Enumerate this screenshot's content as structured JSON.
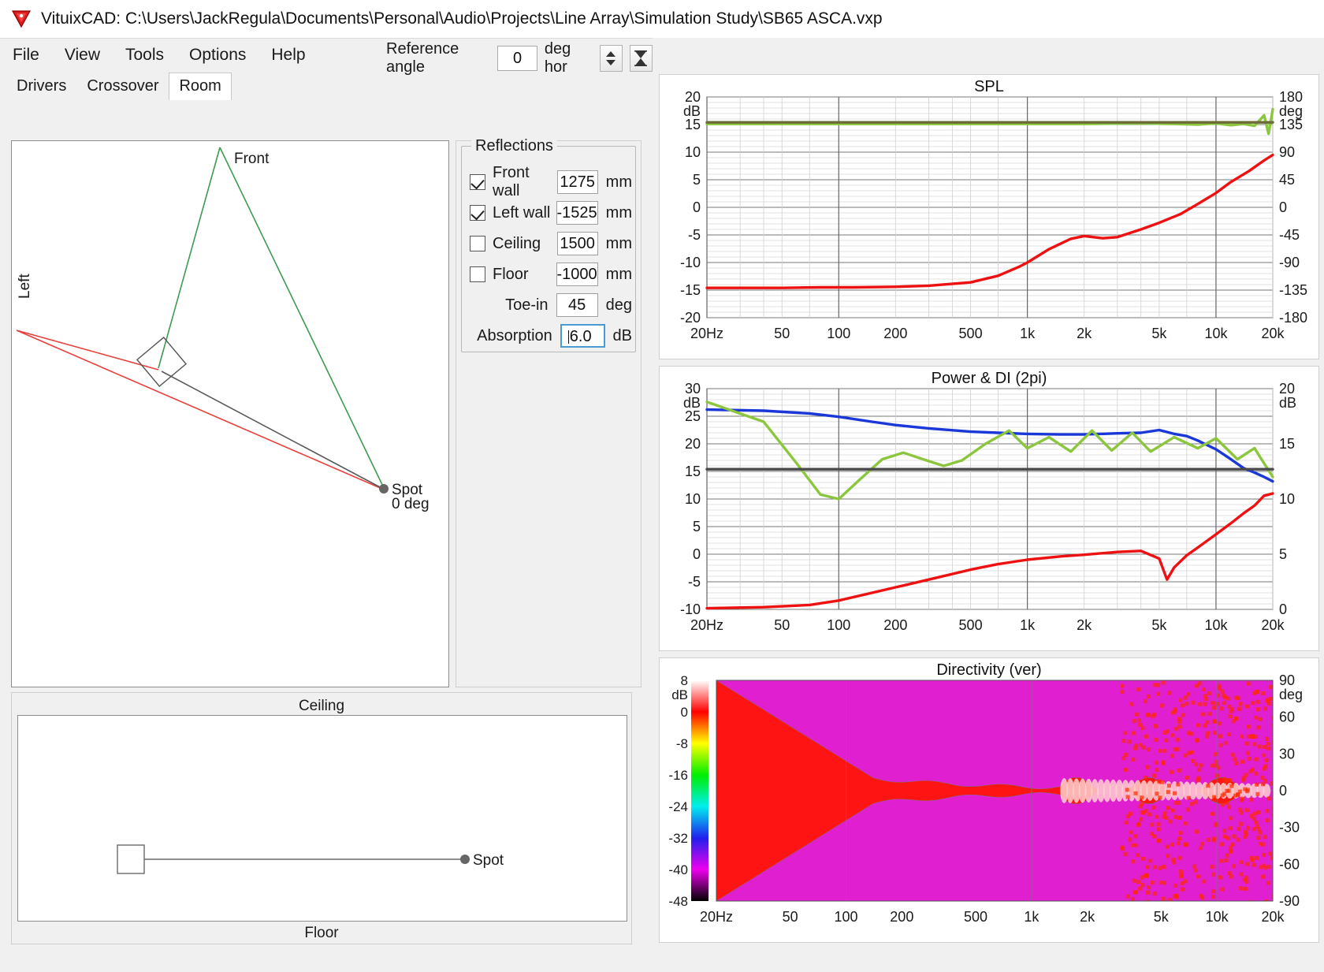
{
  "window": {
    "title": "VituixCAD: C:\\Users\\JackRegula\\Documents\\Personal\\Audio\\Projects\\Line Array\\Simulation Study\\SB65 ASCA.vxp",
    "logo_icon": "vituixcad-logo-icon"
  },
  "menubar": {
    "items": [
      "File",
      "View",
      "Tools",
      "Options",
      "Help"
    ],
    "reference_angle": {
      "label": "Reference angle",
      "value": "0",
      "unit": "deg hor",
      "spinner_icon": "up-down-spinner-icon",
      "hourglass_icon": "hourglass-icon"
    }
  },
  "tabs": {
    "items": [
      "Drivers",
      "Crossover",
      "Room"
    ],
    "active": "Room"
  },
  "room_top": {
    "labels": {
      "front": "Front",
      "left": "Left",
      "spot": "Spot",
      "spot_angle": "0 deg"
    },
    "colors": {
      "front_path": "#3e9b4f",
      "left_path": "#e8403a",
      "direct_path": "#5a5a5a",
      "speaker_outline": "#555555",
      "spot_marker": "#666666"
    }
  },
  "reflections": {
    "legend": "Reflections",
    "rows": [
      {
        "label": "Front wall",
        "checked": true,
        "value": "1275",
        "unit": "mm"
      },
      {
        "label": "Left wall",
        "checked": true,
        "value": "-1525",
        "unit": "mm"
      },
      {
        "label": "Ceiling",
        "checked": false,
        "value": "1500",
        "unit": "mm"
      },
      {
        "label": "Floor",
        "checked": false,
        "value": "-1000",
        "unit": "mm"
      }
    ],
    "toe_in": {
      "label": "Toe-in",
      "value": "45",
      "unit": "deg"
    },
    "absorption": {
      "label": "Absorption",
      "value": "6.0",
      "unit": "dB",
      "focused": true
    }
  },
  "room_side": {
    "labels": {
      "ceiling": "Ceiling",
      "floor": "Floor",
      "spot": "Spot"
    }
  },
  "chart_data": [
    {
      "type": "line",
      "title": "SPL",
      "xlabel": "",
      "ylabel": "dB",
      "y2label": "deg",
      "x_ticks": [
        "20Hz",
        "50",
        "100",
        "200",
        "500",
        "1k",
        "2k",
        "5k",
        "10k",
        "20k"
      ],
      "xlim": [
        20,
        20000
      ],
      "ylim": [
        -20,
        20
      ],
      "y_ticks": [
        20,
        15,
        10,
        5,
        0,
        -5,
        -10,
        -15,
        -20
      ],
      "y2lim": [
        -180,
        180
      ],
      "y2_ticks": [
        180,
        135,
        90,
        45,
        0,
        -45,
        -90,
        -135,
        -180
      ],
      "grid": true,
      "series": [
        {
          "name": "SPL magnitude",
          "color": "#ee1111",
          "x": [
            20,
            30,
            50,
            80,
            120,
            200,
            300,
            500,
            700,
            900,
            1000,
            1300,
            1700,
            2000,
            2500,
            3000,
            4000,
            5000,
            6500,
            8000,
            10000,
            12000,
            15000,
            18000,
            20000
          ],
          "values": [
            -14.6,
            -14.6,
            -14.6,
            -14.5,
            -14.5,
            -14.4,
            -14.2,
            -13.6,
            -12.4,
            -10.8,
            -10.0,
            -7.6,
            -5.7,
            -5.2,
            -5.6,
            -5.4,
            -4.0,
            -2.8,
            -1.2,
            0.6,
            2.6,
            4.6,
            6.6,
            8.5,
            9.5
          ]
        },
        {
          "name": "Phase",
          "color": "#8cc63e",
          "x": [
            20,
            100,
            500,
            1000,
            2000,
            4000,
            6000,
            8000,
            10000,
            12000,
            14000,
            16000,
            18000,
            19000,
            20000
          ],
          "values": [
            136,
            136,
            136,
            136,
            136,
            137,
            136,
            135,
            137,
            134,
            136,
            133,
            150,
            120,
            160
          ]
        },
        {
          "name": "Reference",
          "color": "#6b6b38",
          "x": [
            20,
            20000
          ],
          "values": [
            15.4,
            15.4
          ]
        }
      ]
    },
    {
      "type": "line",
      "title": "Power & DI (2pi)",
      "xlabel": "",
      "ylabel": "dB",
      "y2label": "dB",
      "x_ticks": [
        "20Hz",
        "50",
        "100",
        "200",
        "500",
        "1k",
        "2k",
        "5k",
        "10k",
        "20k"
      ],
      "xlim": [
        20,
        20000
      ],
      "ylim": [
        -10,
        30
      ],
      "y_ticks": [
        30,
        25,
        20,
        15,
        10,
        5,
        0,
        -5,
        -10
      ],
      "y2lim": [
        0,
        20
      ],
      "y2_ticks": [
        20,
        15,
        10,
        5,
        0
      ],
      "grid": true,
      "series": [
        {
          "name": "Power",
          "color": "#1a38d8",
          "x": [
            20,
            40,
            70,
            100,
            150,
            200,
            300,
            500,
            700,
            1000,
            1500,
            2000,
            3000,
            4000,
            5000,
            6000,
            7000,
            8000,
            10000,
            12000,
            14000,
            16000,
            18000,
            20000
          ],
          "values": [
            26.2,
            26.0,
            25.5,
            24.9,
            24.0,
            23.4,
            22.8,
            22.2,
            22.0,
            21.8,
            21.7,
            21.7,
            21.9,
            22.0,
            22.5,
            21.8,
            21.4,
            20.6,
            19.0,
            17.2,
            15.6,
            14.8,
            14.0,
            13.2
          ]
        },
        {
          "name": "Directivity index",
          "color": "#8cc63e",
          "x": [
            20,
            40,
            60,
            80,
            100,
            130,
            170,
            220,
            280,
            360,
            450,
            600,
            800,
            1000,
            1300,
            1700,
            2200,
            2800,
            3600,
            4500,
            6000,
            8000,
            10000,
            13000,
            16000,
            20000
          ],
          "values": [
            18.8,
            17.0,
            13.2,
            10.4,
            10.0,
            11.8,
            13.6,
            14.2,
            13.6,
            13.0,
            13.5,
            15.0,
            16.2,
            14.6,
            15.6,
            14.3,
            16.2,
            14.4,
            16.0,
            14.3,
            15.6,
            14.6,
            15.5,
            13.6,
            14.6,
            12.0
          ]
        },
        {
          "name": "Listening window / ref",
          "color": "#ee1111",
          "x": [
            20,
            40,
            70,
            100,
            150,
            200,
            300,
            500,
            700,
            1000,
            1500,
            2000,
            3000,
            4000,
            5000,
            5500,
            6000,
            7000,
            8000,
            10000,
            12000,
            14000,
            16000,
            18000,
            20000
          ],
          "values": [
            -9.8,
            -9.6,
            -9.2,
            -8.4,
            -7.0,
            -6.0,
            -4.6,
            -2.8,
            -1.8,
            -1.0,
            -0.4,
            -0.1,
            0.4,
            0.6,
            -0.8,
            -4.6,
            -2.4,
            -0.2,
            1.2,
            3.6,
            5.6,
            7.4,
            8.8,
            10.6,
            11.0
          ]
        },
        {
          "name": "Reference",
          "color": "#4a4a4a",
          "x": [
            20,
            20000
          ],
          "values": [
            15.4,
            15.4
          ]
        }
      ]
    },
    {
      "type": "heatmap",
      "title": "Directivity (ver)",
      "xlabel": "",
      "ylabel": "dB",
      "y2label": "deg",
      "x_ticks": [
        "20Hz",
        "50",
        "100",
        "200",
        "500",
        "1k",
        "2k",
        "5k",
        "10k",
        "20k"
      ],
      "xlim": [
        20,
        20000
      ],
      "y2lim": [
        -90,
        90
      ],
      "y2_ticks": [
        90,
        60,
        30,
        0,
        -30,
        -60,
        -90
      ],
      "colorbar": {
        "label": "dB",
        "ticks": [
          8,
          0,
          -8,
          -16,
          -24,
          -32,
          -40,
          -48
        ],
        "colors": [
          "#ffffff",
          "#ff0000",
          "#ffff00",
          "#00ee00",
          "#00eeee",
          "#2020ee",
          "#ee00ee",
          "#000000"
        ]
      }
    }
  ]
}
